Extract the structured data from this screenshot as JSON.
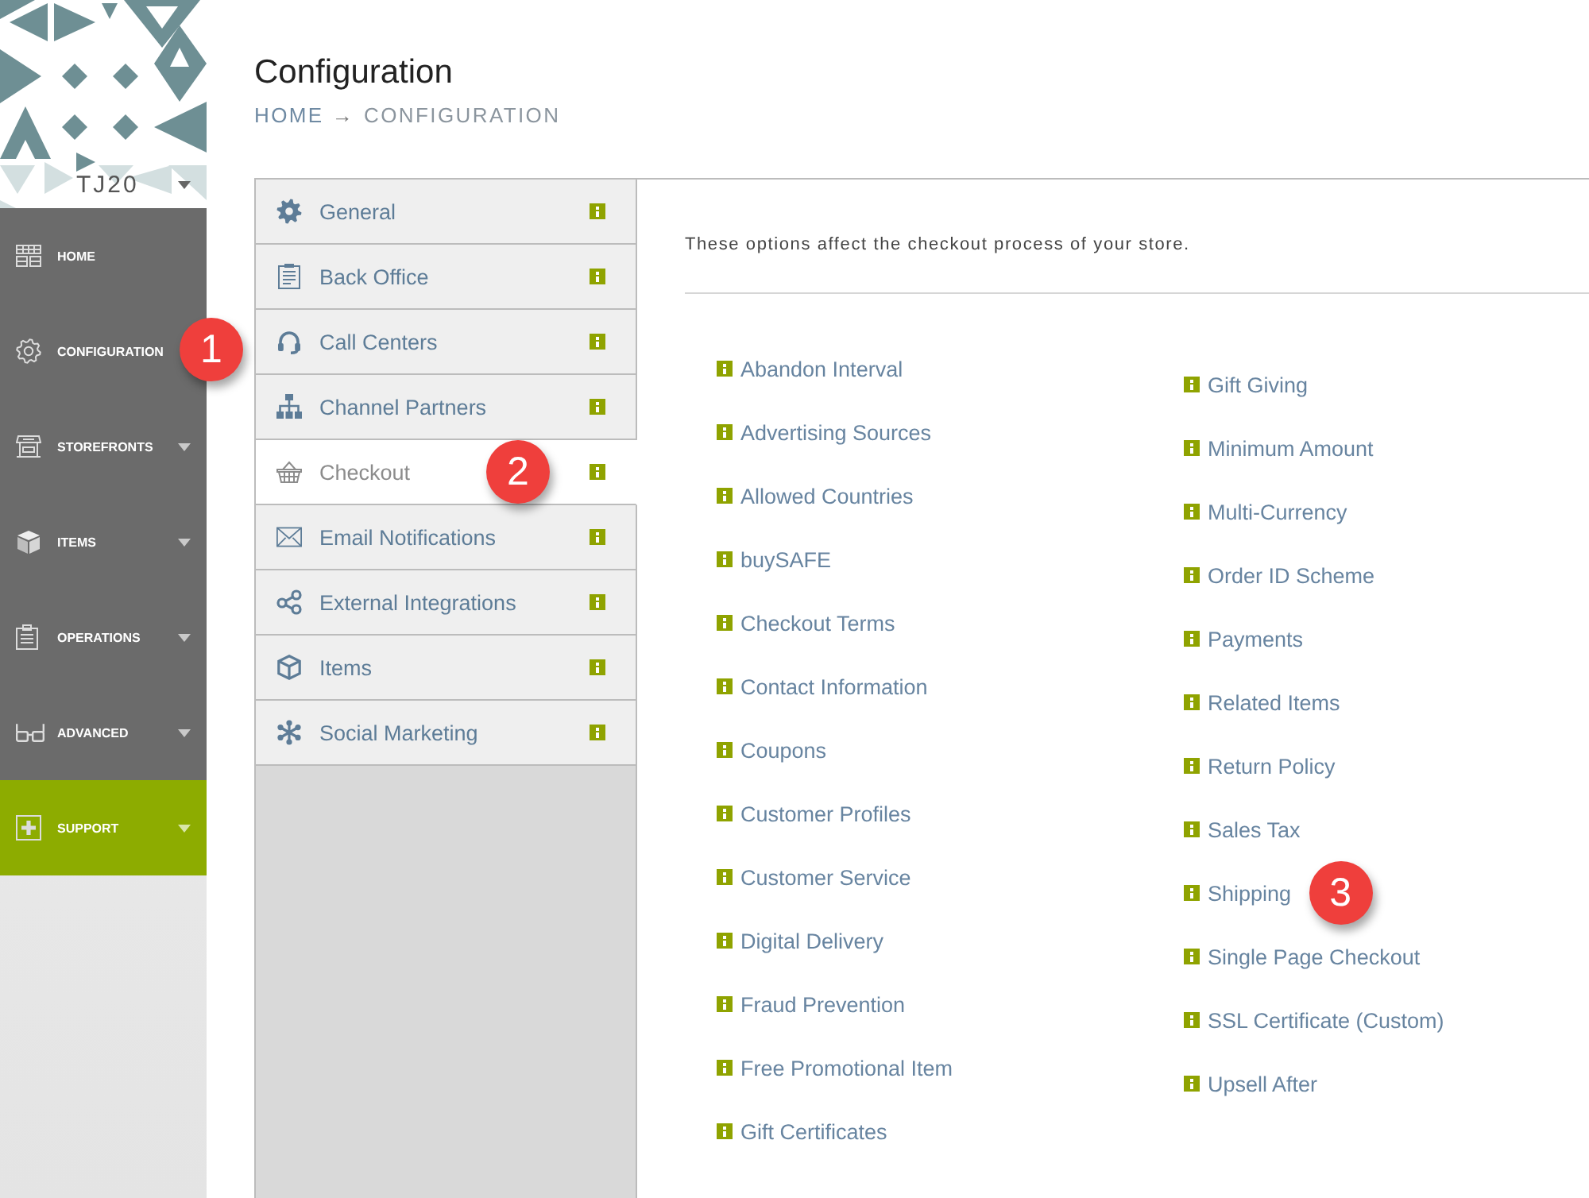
{
  "sidebar": {
    "store_switcher": {
      "label": "TJ20"
    },
    "nav": [
      {
        "label": "HOME",
        "expandable": false,
        "highlighted": false
      },
      {
        "label": "CONFIGURATION",
        "expandable": false,
        "highlighted": false,
        "callout": "1"
      },
      {
        "label": "STOREFRONTS",
        "expandable": true,
        "highlighted": false
      },
      {
        "label": "ITEMS",
        "expandable": true,
        "highlighted": false
      },
      {
        "label": "OPERATIONS",
        "expandable": true,
        "highlighted": false
      },
      {
        "label": "ADVANCED",
        "expandable": true,
        "highlighted": false
      },
      {
        "label": "SUPPORT",
        "expandable": true,
        "highlighted": true
      }
    ]
  },
  "header": {
    "title": "Configuration",
    "breadcrumb": [
      {
        "label": "HOME"
      },
      {
        "label": "CONFIGURATION"
      }
    ],
    "separator": "→"
  },
  "tabs": [
    {
      "label": "General",
      "selected": false
    },
    {
      "label": "Back Office",
      "selected": false
    },
    {
      "label": "Call Centers",
      "selected": false
    },
    {
      "label": "Channel Partners",
      "selected": false
    },
    {
      "label": "Checkout",
      "selected": true,
      "callout": "2"
    },
    {
      "label": "Email Notifications",
      "selected": false
    },
    {
      "label": "External Integrations",
      "selected": false
    },
    {
      "label": "Items",
      "selected": false
    },
    {
      "label": "Social Marketing",
      "selected": false
    }
  ],
  "panel": {
    "description": "These options affect the checkout process of your store.",
    "columns": [
      [
        {
          "label": "Abandon Interval"
        },
        {
          "label": "Advertising Sources"
        },
        {
          "label": "Allowed Countries"
        },
        {
          "label": "buySAFE"
        },
        {
          "label": "Checkout Terms"
        },
        {
          "label": "Contact Information"
        },
        {
          "label": "Coupons"
        },
        {
          "label": "Customer Profiles"
        },
        {
          "label": "Customer Service"
        },
        {
          "label": "Digital Delivery"
        },
        {
          "label": "Fraud Prevention"
        },
        {
          "label": "Free Promotional Item"
        },
        {
          "label": "Gift Certificates"
        }
      ],
      [
        {
          "label": "Gift Giving"
        },
        {
          "label": "Minimum Amount"
        },
        {
          "label": "Multi-Currency"
        },
        {
          "label": "Order ID Scheme"
        },
        {
          "label": "Payments"
        },
        {
          "label": "Related Items"
        },
        {
          "label": "Return Policy"
        },
        {
          "label": "Sales Tax"
        },
        {
          "label": "Shipping",
          "callout": "3"
        },
        {
          "label": "Single Page Checkout"
        },
        {
          "label": "SSL Certificate (Custom)"
        },
        {
          "label": "Upsell After"
        }
      ]
    ]
  }
}
